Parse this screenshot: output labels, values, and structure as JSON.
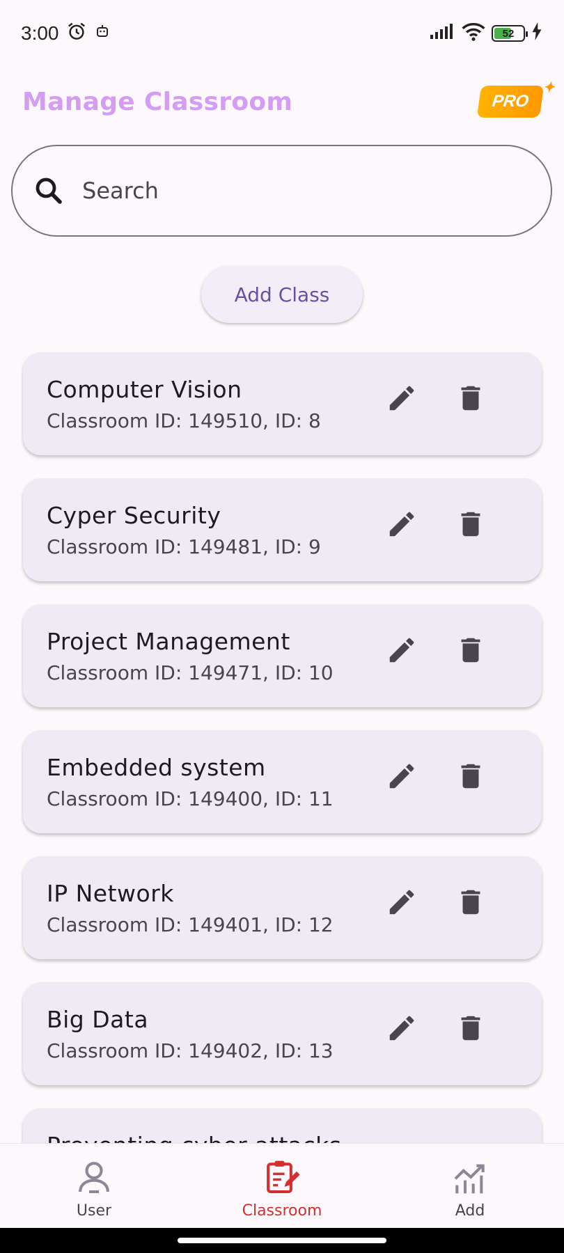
{
  "status_bar": {
    "time": "3:00",
    "battery_level": "52"
  },
  "app_bar": {
    "title": "Manage Classroom",
    "pro_badge": "PRO"
  },
  "search": {
    "placeholder": "Search",
    "value": ""
  },
  "add_class_label": "Add Class",
  "classes": [
    {
      "name": "Computer Vision",
      "details": "Classroom ID: 149510, ID: 8"
    },
    {
      "name": "Cyper Security",
      "details": "Classroom ID: 149481, ID: 9"
    },
    {
      "name": "Project Management",
      "details": "Classroom ID: 149471, ID: 10"
    },
    {
      "name": "Embedded system",
      "details": "Classroom ID: 149400, ID: 11"
    },
    {
      "name": "IP Network",
      "details": "Classroom ID: 149401, ID: 12"
    },
    {
      "name": "Big Data",
      "details": "Classroom ID: 149402, ID: 13"
    },
    {
      "name": "Preventing cyber attacks",
      "details": ""
    }
  ],
  "bottom_nav": {
    "items": [
      {
        "label": "User",
        "icon": "person-icon",
        "active": false
      },
      {
        "label": "Classroom",
        "icon": "classroom-edit-icon",
        "active": true
      },
      {
        "label": "Add",
        "icon": "chart-icon",
        "active": false
      }
    ]
  },
  "colors": {
    "title": "#D59CF3",
    "accent": "#6750A4",
    "active_nav": "#D32F2F",
    "card_bg": "#EFEAF3",
    "page_bg": "#FDF8FC"
  }
}
